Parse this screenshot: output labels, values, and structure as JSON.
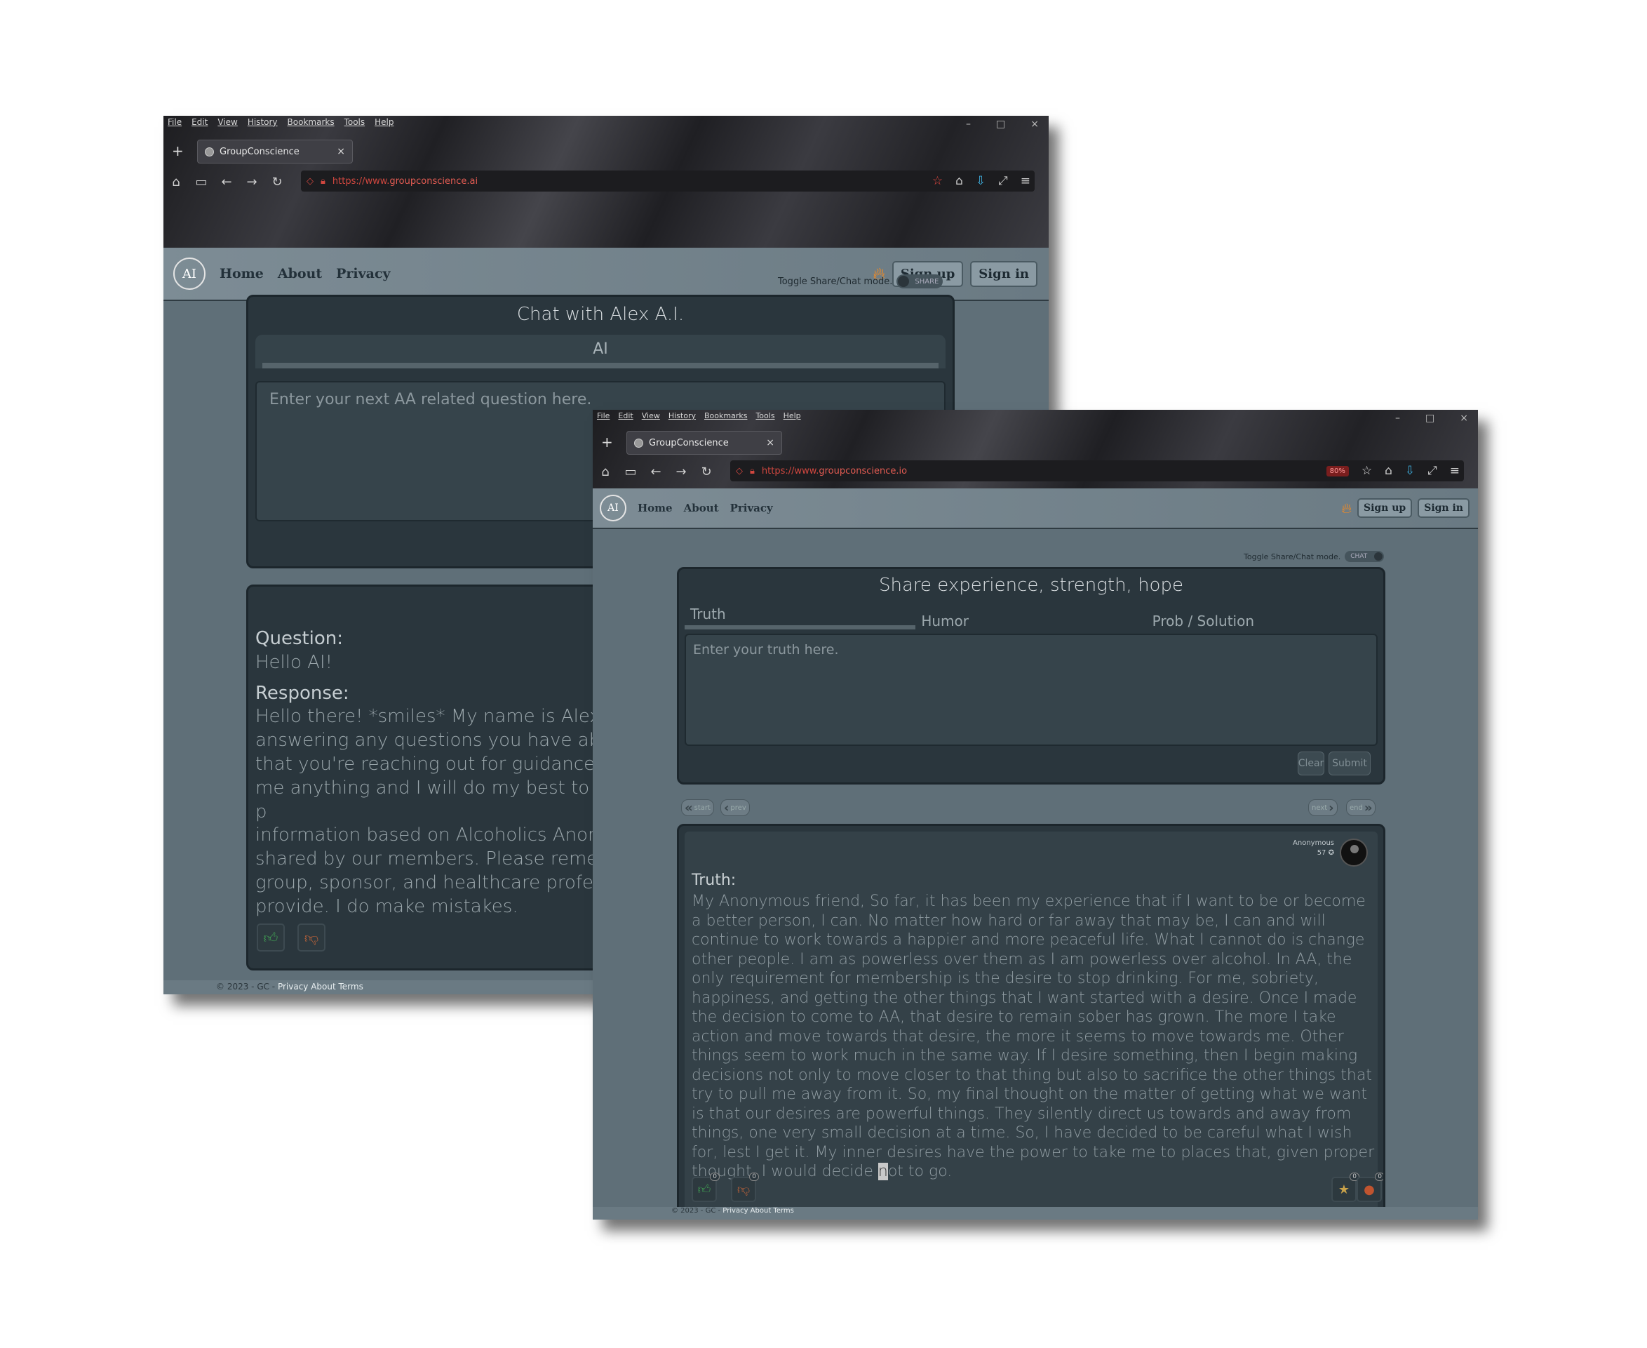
{
  "browser": {
    "menu": [
      "File",
      "Edit",
      "View",
      "History",
      "Bookmarks",
      "Tools",
      "Help"
    ],
    "tab_title": "GroupConscience",
    "new_tab": "+",
    "close_tab": "×",
    "window_controls": [
      "–",
      "□",
      "×"
    ]
  },
  "window1": {
    "url_prefix": "https://www.",
    "url_domain": "groupconscience.ai",
    "nav": {
      "logo": "AI",
      "home": "Home",
      "about": "About",
      "privacy": "Privacy"
    },
    "signup": "Sign up",
    "signin": "Sign in",
    "toggle_label": "Toggle Share/Chat mode.",
    "toggle_state": "SHARE",
    "chat_title": "Chat with Alex A.I.",
    "ai_tab": "AI",
    "input_placeholder": "Enter your next AA related question here.",
    "question_label": "Question:",
    "question_text": "Hello AI!",
    "response_label": "Response:",
    "response_lines": [
      "Hello there! *smiles* My name is Alex",
      "answering any questions you have ab",
      "that you're reaching out for guidance",
      "me anything and I will do my best to p",
      "information based on Alcoholics Anon",
      "shared by our members. Please reme",
      "group, sponsor, and healthcare profe",
      "provide. I do make mistakes."
    ],
    "footer_text": "© 2023 - GC - ",
    "footer_links": "Privacy About Terms"
  },
  "window2": {
    "url_prefix": "https://www.",
    "url_domain": "groupconscience.io",
    "zoom": "80%",
    "nav": {
      "logo": "AI",
      "home": "Home",
      "about": "About",
      "privacy": "Privacy"
    },
    "signup": "Sign up",
    "signin": "Sign in",
    "toggle_label": "Toggle Share/Chat mode.",
    "toggle_state": "CHAT",
    "share_title": "Share experience, strength, hope",
    "tabs": [
      "Truth",
      "Humor",
      "Prob / Solution"
    ],
    "input_placeholder": "Enter your truth here.",
    "clear": "Clear",
    "submit": "Submit",
    "pager": {
      "start": "start",
      "prev": "prev",
      "next": "next",
      "end": "end"
    },
    "author": "Anonymous",
    "author_score": "57",
    "post_label": "Truth:",
    "post_before_cursor": "My Anonymous friend, So far, it has been my experience that if I want to be or become a better person, I can. No matter how hard or far away that may be, I can and will continue to work towards a happier and more peaceful life. What I cannot do is change other people. I am as powerless over them as I am powerless over alcohol. In AA, the only requirement for membership is the desire to stop drinking. For me, sobriety, happiness, and getting the other things that I want started with a desire. Once I made the decision to come to AA, that desire to remain sober has grown. The more I take action and move towards that desire, the more it seems to move towards me. Other things seem to work much in the same way. If I desire something, then I begin making decisions not only to move closer to that thing but also to sacrifice the other things that try to pull me away from it. So, my final thought on the matter of getting what we want is that our desires are powerful things. They silently direct us towards and away from things, one very small decision at a time. So, I have decided to be careful what I wish for, lest I get it. My inner desires have the power to take me to places that, given proper thought, I would decide ",
    "post_cursor_char": "n",
    "post_after_cursor": "ot to go.",
    "counts": {
      "up": "0",
      "down": "0",
      "star": "0",
      "flag": "0"
    },
    "footer_text": "© 2023 - GC - ",
    "footer_links": "Privacy About Terms"
  },
  "colors": {
    "accent_flame": "#ff8c1a",
    "thumb_up": "#3f9a52",
    "thumb_down": "#b5603a",
    "url_domain": "#e25b52"
  }
}
